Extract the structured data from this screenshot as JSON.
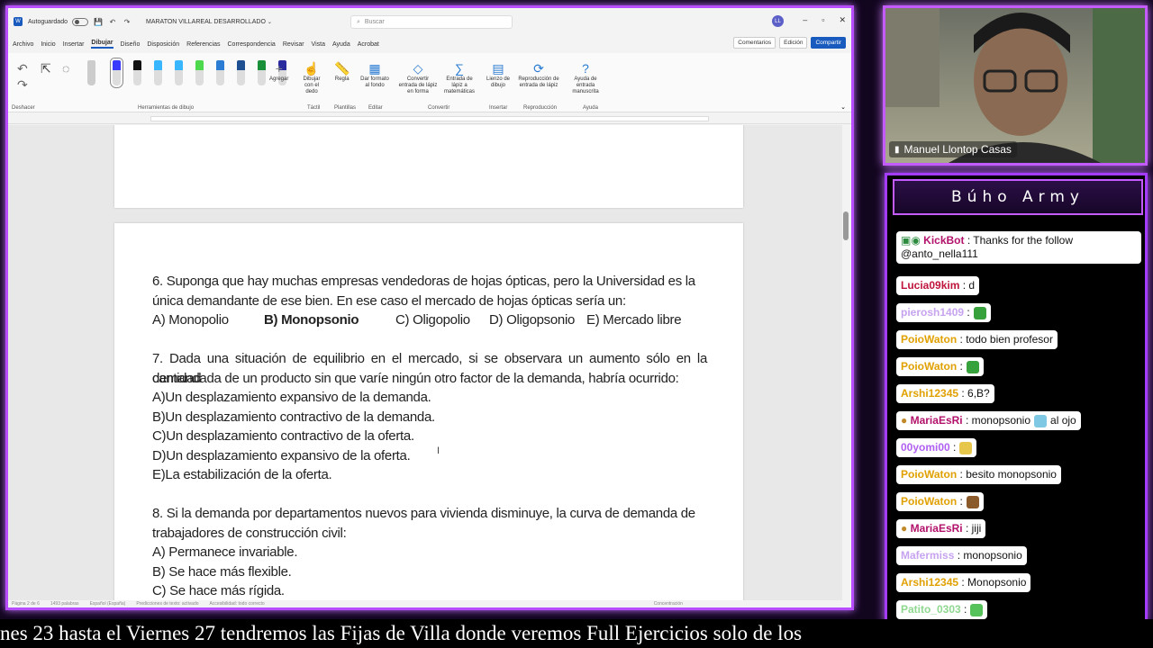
{
  "word": {
    "autosave_label": "Autoguardado",
    "doc_title": "MARATON VILLAREAL DESARROLLADO",
    "search_placeholder": "Buscar",
    "menu": [
      "Archivo",
      "Inicio",
      "Insertar",
      "Dibujar",
      "Diseño",
      "Disposición",
      "Referencias",
      "Correspondencia",
      "Revisar",
      "Vista",
      "Ayuda",
      "Acrobat"
    ],
    "active_menu": "Dibujar",
    "btn_comments": "Comentarios",
    "btn_edit": "Edición",
    "btn_share": "Compartir",
    "user_initials": "LL",
    "ribbon": {
      "undo_group": "Deshacer",
      "tools_group": "Herramientas de dibujo",
      "add_label": "Agregar",
      "draw_finger": "Dibujar con el dedo",
      "ruler": "Regla",
      "format_bg": "Dar formato al fondo",
      "convert_shape": "Convertir entrada de lápiz en forma",
      "ink_math": "Entrada de lápiz a matemáticas",
      "canvas": "Lienzo de dibujo",
      "replay": "Reproducción de entrada de lápiz",
      "ink_help": "Ayuda de entrada manuscrita",
      "groups": [
        "Táctil",
        "Plantillas",
        "Editar",
        "Convertir",
        "Insertar",
        "Reproducción",
        "Ayuda"
      ],
      "pen_colors": [
        "#3a3aff",
        "#111111",
        "#38b6ff",
        "#38b6ff",
        "#4dd84d",
        "#2b7cd3",
        "#1d4f91",
        "#1a8f3a",
        "#2a2a9f"
      ]
    },
    "status": [
      "Página 2 de 6",
      "1493 palabras",
      "Español (España)",
      "Predicciones de texto: activado",
      "Accesibilidad: todo correcto",
      "Concentración"
    ],
    "questions": {
      "q6_line1": "6. Suponga que hay muchas empresas vendedoras de hojas ópticas, pero la Universidad es la",
      "q6_line2": "única demandante de ese bien. En ese caso el mercado de hojas ópticas sería un:",
      "q6_opts": [
        "A) Monopolio",
        "B) Monopsonio",
        "C) Oligopolio",
        "D) Oligopsonio",
        "E) Mercado libre"
      ],
      "q7_line1": "7. Dada una situación de equilibrio en el mercado, si se observara un aumento sólo en la cantidad",
      "q7_line2": "demandada de un producto sin que varíe ningún otro factor de la demanda, habría ocurrido:",
      "q7_opts": [
        "A)Un desplazamiento expansivo de la demanda.",
        "B)Un desplazamiento contractivo de la demanda.",
        "C)Un desplazamiento contractivo de la oferta.",
        "D)Un desplazamiento expansivo de la oferta.",
        "E)La estabilización de la oferta."
      ],
      "q8_line1": "8. Si la demanda por departamentos nuevos para vivienda disminuye, la curva de demanda de",
      "q8_line2": "trabajadores de construcción civil:",
      "q8_opts": [
        "A) Permanece invariable.",
        "B) Se hace más flexible.",
        "C) Se hace más rígida."
      ]
    }
  },
  "cam": {
    "name": "Manuel Llontop Casas"
  },
  "chat": {
    "title": "Búho Army",
    "messages": [
      {
        "nick": "KickBot",
        "color": "#b3126b",
        "text": ": Thanks for the follow",
        "text2": "@anto_nella111"
      },
      {
        "nick": "Lucia09kim",
        "color": "#c0143c",
        "text": ": d"
      },
      {
        "nick": "pierosh1409",
        "color": "#c7a3f0",
        "text": ":"
      },
      {
        "nick": "PoioWaton",
        "color": "#e0a000",
        "text": ": todo bien profesor"
      },
      {
        "nick": "PoioWaton",
        "color": "#e0a000",
        "text": ":"
      },
      {
        "nick": "Arshi12345",
        "color": "#e0a000",
        "text": ": 6,B?"
      },
      {
        "nick": "MariaEsRi",
        "color": "#b3126b",
        "text": ": monopsonio",
        "text2": "al ojo"
      },
      {
        "nick": "00yomi00",
        "color": "#b060f0",
        "text": ":"
      },
      {
        "nick": "PoioWaton",
        "color": "#e0a000",
        "text": ": besito monopsonio"
      },
      {
        "nick": "PoioWaton",
        "color": "#e0a000",
        "text": ":"
      },
      {
        "nick": "MariaEsRi",
        "color": "#b3126b",
        "text": ": jiji"
      },
      {
        "nick": "Mafermiss",
        "color": "#c7a3f0",
        "text": ": monopsonio"
      },
      {
        "nick": "Arshi12345",
        "color": "#e0a000",
        "text": ": Monopsonio"
      },
      {
        "nick": "Patito_0303",
        "color": "#8fd88f",
        "text": ":"
      }
    ]
  },
  "ticker": "nes 23 hasta el Viernes 27 tendremos las Fijas de Villa donde veremos Full Ejercicios solo de los"
}
